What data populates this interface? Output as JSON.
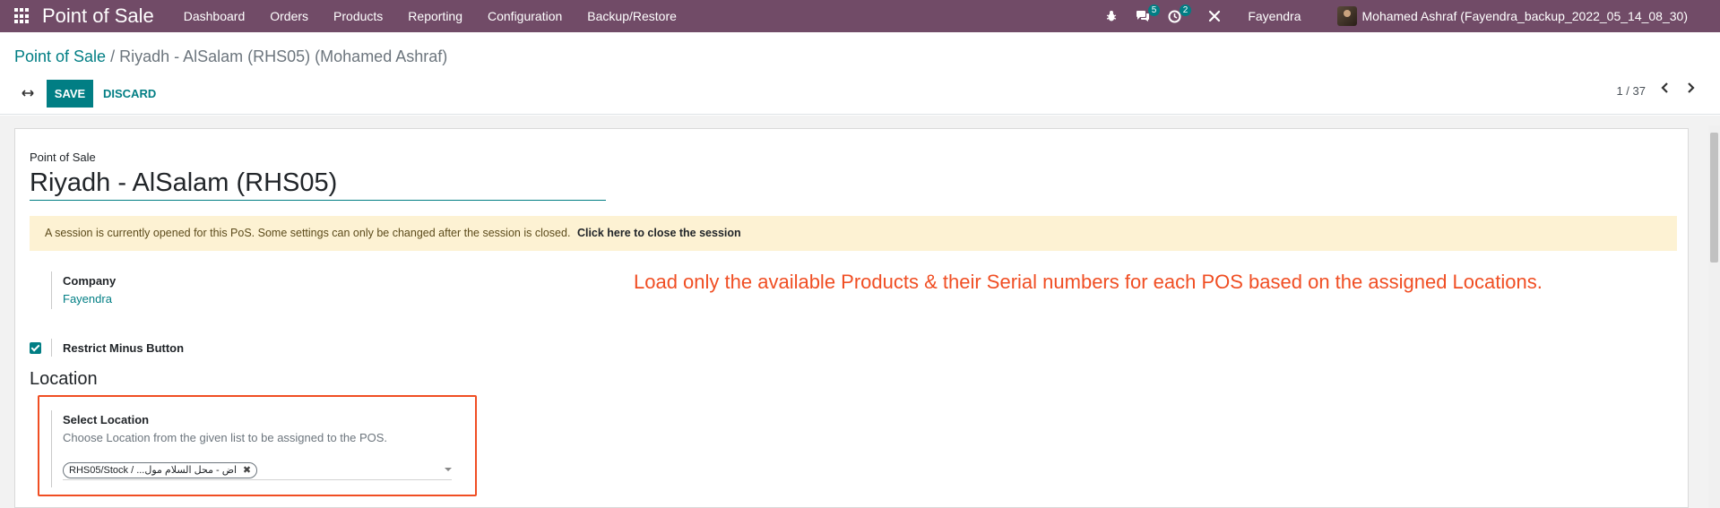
{
  "navbar": {
    "brand": "Point of Sale",
    "menu": [
      "Dashboard",
      "Orders",
      "Products",
      "Reporting",
      "Configuration",
      "Backup/Restore"
    ],
    "messages_badge": "5",
    "activity_badge": "2",
    "company": "Fayendra",
    "user": "Mohamed Ashraf (Fayendra_backup_2022_05_14_08_30)",
    "icons": [
      "apps-grid-icon",
      "bug-icon",
      "chat-icon",
      "clock-icon",
      "tools-icon",
      "avatar"
    ]
  },
  "control_panel": {
    "breadcrumb_root": "Point of Sale",
    "breadcrumb_separator": " / ",
    "breadcrumb_current": "Riyadh - AlSalam (RHS05) (Mohamed Ashraf)",
    "save_label": "SAVE",
    "discard_label": "DISCARD",
    "pager": "1 / 37"
  },
  "form": {
    "pos_label": "Point of Sale",
    "pos_name": "Riyadh - AlSalam (RHS05)",
    "alert_text": "A session is currently opened for this PoS. Some settings can only be changed after the session is closed.",
    "alert_link": "Click here to close the session",
    "company_label": "Company",
    "company_value": "Fayendra",
    "annotation": "Load only the available Products & their Serial numbers for each POS based on the assigned Locations.",
    "restrict_minus_label": "Restrict Minus Button",
    "restrict_minus_checked": true,
    "location_section": "Location",
    "select_location_label": "Select Location",
    "select_location_help": "Choose Location from the given list to be assigned to the POS.",
    "location_tag": "RHS05/Stock / ...اض - محل السلام مول"
  },
  "colors": {
    "navbar": "#714B67",
    "accent": "#017E84",
    "annotation": "#f04e23",
    "alert_bg": "#fdf2d3"
  }
}
